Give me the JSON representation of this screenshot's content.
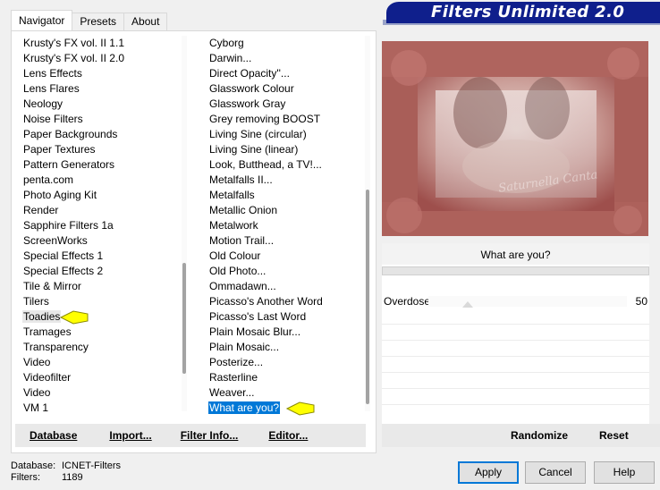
{
  "window": {
    "banner_title": "Filters Unlimited 2.0"
  },
  "tabs": [
    {
      "label": "Navigator",
      "active": true
    },
    {
      "label": "Presets",
      "active": false
    },
    {
      "label": "About",
      "active": false
    }
  ],
  "categories": {
    "items": [
      "Krusty's FX vol. II 1.1",
      "Krusty's FX vol. II 2.0",
      "Lens Effects",
      "Lens Flares",
      "Neology",
      "Noise Filters",
      "Paper Backgrounds",
      "Paper Textures",
      "Pattern Generators",
      "penta.com",
      "Photo Aging Kit",
      "Render",
      "Sapphire Filters 1a",
      "ScreenWorks",
      "Special Effects 1",
      "Special Effects 2",
      "Tile & Mirror",
      "Tilers",
      "Toadies",
      "Tramages",
      "Transparency",
      "Video",
      "Videofilter",
      "Video",
      "VM 1"
    ],
    "selected": "Toadies"
  },
  "filters": {
    "items": [
      "Cyborg",
      "Darwin...",
      "Direct Opacity''...",
      "Glasswork Colour",
      "Glasswork Gray",
      "Grey removing BOOST",
      "Living Sine (circular)",
      "Living Sine (linear)",
      "Look, Butthead, a TV!...",
      "Metalfalls II...",
      "Metalfalls",
      "Metallic Onion",
      "Metalwork",
      "Motion Trail...",
      "Old Colour",
      "Old Photo...",
      "Ommadawn...",
      "Picasso's Another Word",
      "Picasso's Last Word",
      "Plain Mosaic Blur...",
      "Plain Mosaic...",
      "Posterize...",
      "Rasterline",
      "Weaver...",
      "What are you?"
    ],
    "selected": "What are you?"
  },
  "left_buttons": {
    "database": "Database",
    "import": "Import...",
    "filter_info": "Filter Info...",
    "editor": "Editor..."
  },
  "preview": {
    "watermark": "Saturnella Canta"
  },
  "effect": {
    "title": "What are you?",
    "param_label": "Overdose",
    "param_value": "50",
    "param_fraction": 0.196
  },
  "right_buttons": {
    "randomize": "Randomize",
    "reset": "Reset"
  },
  "footer": {
    "database_key": "Database:",
    "database_value": "ICNET-Filters",
    "filters_key": "Filters:",
    "filters_value": "1189"
  },
  "dialog_buttons": {
    "apply": "Apply",
    "cancel": "Cancel",
    "help": "Help"
  },
  "colors": {
    "banner": "#0f1f8c",
    "selection": "#0078d7",
    "callout": "#ffff00"
  },
  "icons": [
    "arrow-callout-icon"
  ]
}
